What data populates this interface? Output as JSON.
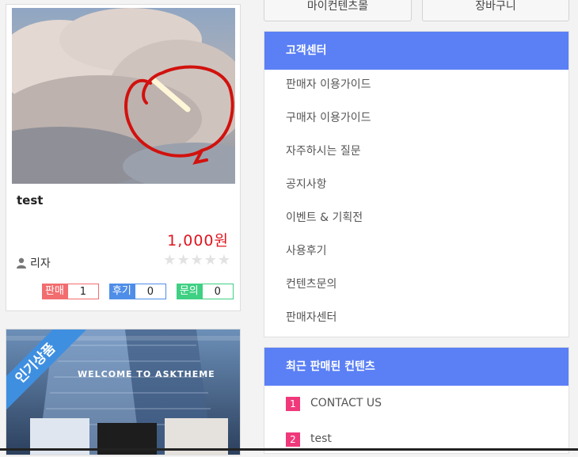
{
  "product": {
    "title": "test",
    "price": "1,000원",
    "seller": "리자",
    "rating": 0,
    "counts": [
      {
        "label": "판매",
        "value": "1"
      },
      {
        "label": "후기",
        "value": "0"
      },
      {
        "label": "문의",
        "value": "0"
      }
    ]
  },
  "second_product": {
    "ribbon": "인기상품",
    "banner_text": "WELCOME TO ASKTHEME"
  },
  "top_buttons": {
    "my_contents": "마이컨텐츠몰",
    "cart": "장바구니"
  },
  "customer_center": {
    "title": "고객센터",
    "items": [
      "판매자 이용가이드",
      "구매자 이용가이드",
      "자주하시는 질문",
      "공지사항",
      "이벤트 & 기획전",
      "사용후기",
      "컨텐츠문의",
      "판매자센터"
    ]
  },
  "recent_sold": {
    "title": "최근 판매된 컨텐츠",
    "items": [
      {
        "rank": "1",
        "name": "CONTACT US"
      },
      {
        "rank": "2",
        "name": "test"
      }
    ]
  },
  "colors": {
    "accent": "#5b80f5",
    "price": "#e0141e",
    "rank": "#f0397a"
  }
}
